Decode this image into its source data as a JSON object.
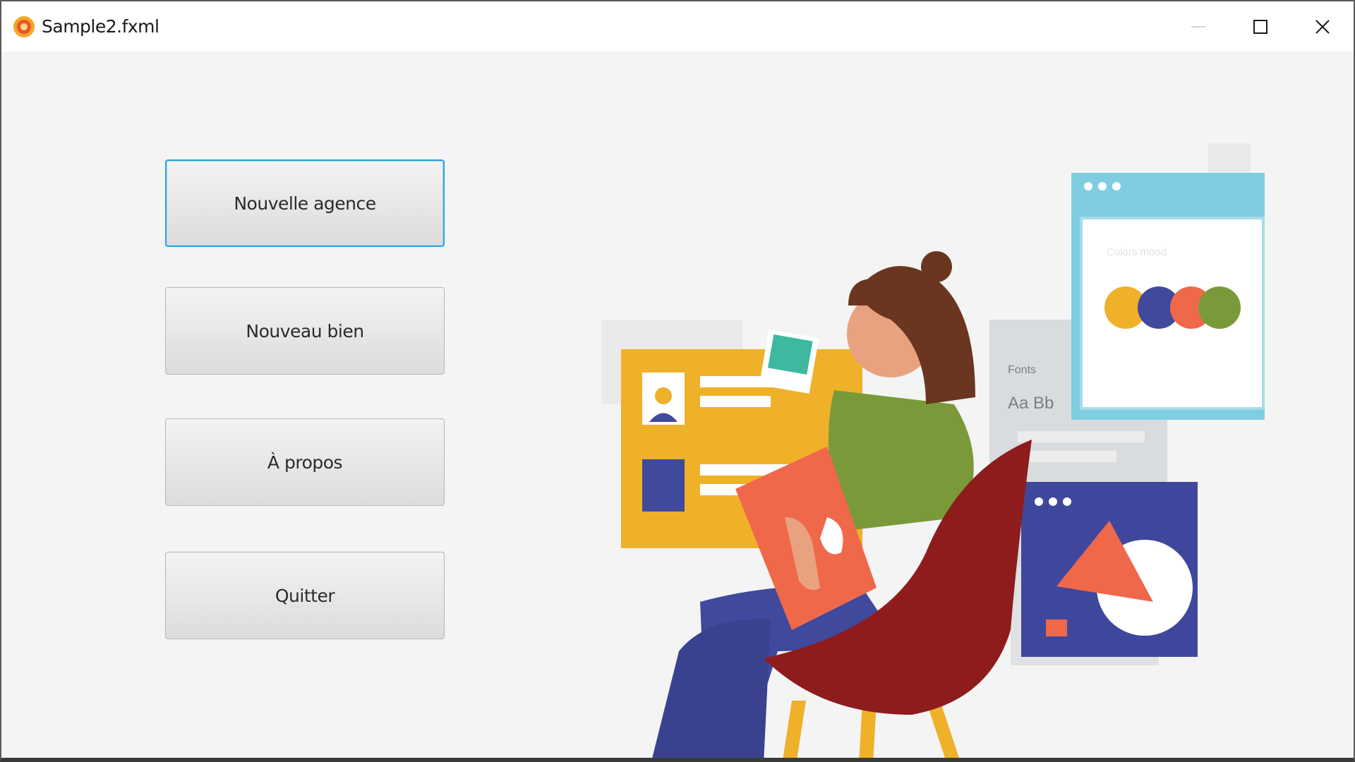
{
  "window": {
    "title": "Sample2.fxml",
    "controls": [
      "minimize",
      "maximize",
      "close"
    ]
  },
  "menu_buttons": [
    {
      "label": "Nouvelle agence",
      "focused": true
    },
    {
      "label": "Nouveau bien",
      "focused": false
    },
    {
      "label": "À propos",
      "focused": false
    },
    {
      "label": "Quitter",
      "focused": false
    }
  ],
  "illustration": {
    "colors_card_text": "Colors mood",
    "fonts_card_title": "Fonts",
    "fonts_card_sample": "Aa  Bb",
    "palette": [
      "#efb02a",
      "#40499c",
      "#f0684a",
      "#7a9a3a"
    ]
  },
  "colors": {
    "accent_focus": "#2ea4dd",
    "background": "#f4f4f4"
  }
}
